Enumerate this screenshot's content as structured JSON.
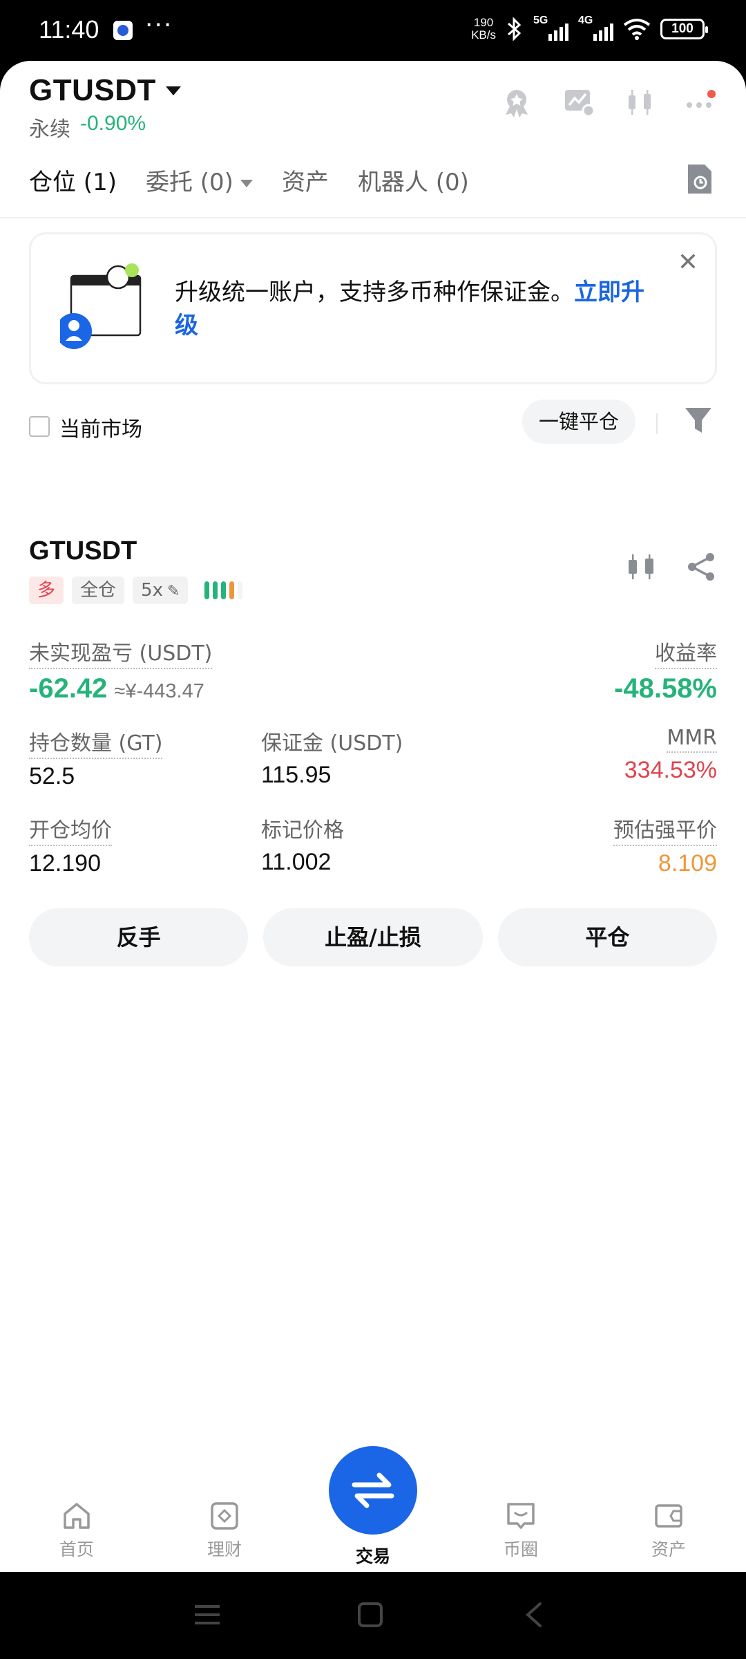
{
  "status_bar": {
    "time": "11:40",
    "net_speed_top": "190",
    "net_speed_bottom": "KB/s",
    "signal1_label": "5G",
    "signal2_label": "4G",
    "battery": "100"
  },
  "header": {
    "pair": "GTUSDT",
    "contract_type": "永续",
    "change": "-0.90%"
  },
  "tabs": [
    {
      "label": "仓位 (1)"
    },
    {
      "label": "委托 (0)"
    },
    {
      "label": "资产"
    },
    {
      "label": "机器人 (0)"
    }
  ],
  "banner": {
    "text": "升级统一账户，支持多币种作保证金。",
    "link": "立即升级",
    "close": "✕"
  },
  "filter": {
    "current_market_label": "当前市场",
    "close_all_label": "一键平仓"
  },
  "position": {
    "symbol": "GTUSDT",
    "side_tag": "多",
    "margin_mode_tag": "全仓",
    "leverage_tag": "5x",
    "unrealized_pnl_label": "未实现盈亏 (USDT)",
    "unrealized_pnl_value": "-62.42",
    "unrealized_pnl_cny": "≈¥-443.47",
    "roe_label": "收益率",
    "roe_value": "-48.58%",
    "size_label": "持仓数量 (GT)",
    "size_value": "52.5",
    "margin_label": "保证金 (USDT)",
    "margin_value": "115.95",
    "mmr_label": "MMR",
    "mmr_value": "334.53%",
    "entry_price_label": "开仓均价",
    "entry_price_value": "12.190",
    "mark_price_label": "标记价格",
    "mark_price_value": "11.002",
    "liq_price_label": "预估强平价",
    "liq_price_value": "8.109"
  },
  "actions": {
    "reverse": "反手",
    "tp_sl": "止盈/止损",
    "close": "平仓"
  },
  "bottom_nav": [
    {
      "label": "首页",
      "icon": "home-icon"
    },
    {
      "label": "理财",
      "icon": "finance-icon"
    },
    {
      "label": "交易",
      "icon": "swap-icon"
    },
    {
      "label": "币圈",
      "icon": "chat-icon"
    },
    {
      "label": "资产",
      "icon": "wallet-icon"
    }
  ],
  "colors": {
    "green": "#26b37a",
    "red": "#e0444d",
    "orange": "#f0953a",
    "accent": "#1a66e6"
  }
}
